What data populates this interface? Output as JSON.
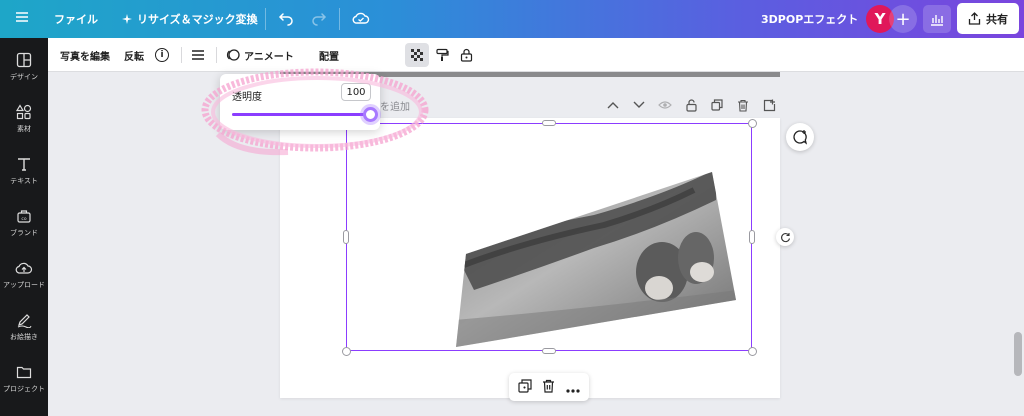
{
  "topbar": {
    "file_label": "ファイル",
    "resize_label": "リサイズ＆マジック変換",
    "design_title": "3DPOPエフェクト",
    "avatar_initial": "Y",
    "plus_label": "+",
    "share_label": "共有"
  },
  "sidebar": {
    "items": [
      {
        "label": "デザイン",
        "icon": "layout-icon"
      },
      {
        "label": "素材",
        "icon": "elements-icon"
      },
      {
        "label": "テキスト",
        "icon": "text-icon"
      },
      {
        "label": "ブランド",
        "icon": "brand-icon"
      },
      {
        "label": "アップロード",
        "icon": "upload-icon"
      },
      {
        "label": "お絵描き",
        "icon": "draw-icon"
      },
      {
        "label": "プロジェクト",
        "icon": "folder-icon"
      }
    ]
  },
  "toolbar": {
    "edit_photo_label": "写真を編集",
    "flip_label": "反転",
    "info_label": "i",
    "animate_label": "アニメート",
    "position_label": "配置"
  },
  "transparency_popover": {
    "label": "透明度",
    "value": "100",
    "slider_fraction": 1.0
  },
  "page": {
    "title_text": "ルを追加"
  },
  "colors": {
    "accent": "#8b3dff",
    "avatar": "#e0185a",
    "sidebar_bg": "#18191b",
    "canvas_bg": "#ebecf0"
  }
}
